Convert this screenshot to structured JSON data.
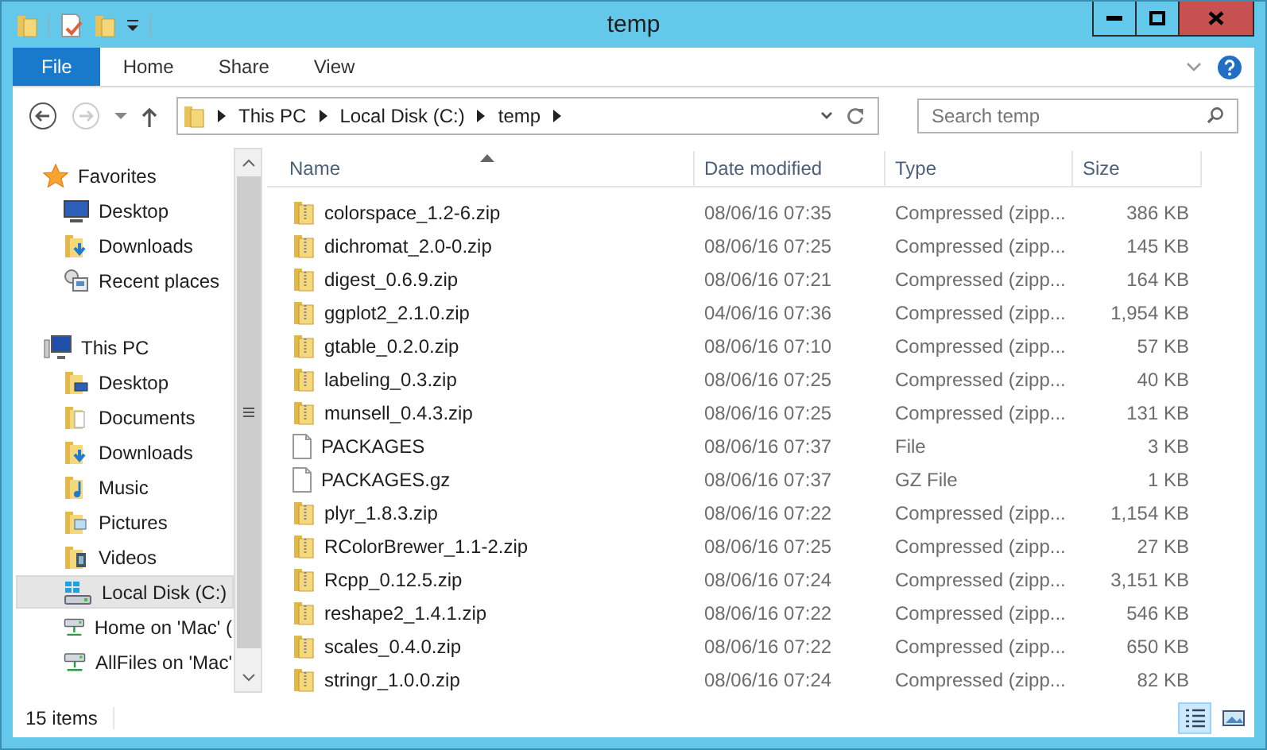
{
  "window": {
    "title": "temp"
  },
  "ribbon_tabs": [
    {
      "label": "File",
      "selected": true
    },
    {
      "label": "Home",
      "selected": false
    },
    {
      "label": "Share",
      "selected": false
    },
    {
      "label": "View",
      "selected": false
    }
  ],
  "address": {
    "segments": [
      "This PC",
      "Local Disk (C:)",
      "temp"
    ]
  },
  "search": {
    "placeholder": "Search temp"
  },
  "sidebar": {
    "groups": [
      {
        "label": "Favorites",
        "kind": "star",
        "children": [
          {
            "label": "Desktop",
            "kind": "monitor",
            "selected": false
          },
          {
            "label": "Downloads",
            "kind": "downloads",
            "selected": false
          },
          {
            "label": "Recent places",
            "kind": "recent",
            "selected": false
          }
        ]
      },
      {
        "label": "This PC",
        "kind": "pc",
        "children": [
          {
            "label": "Desktop",
            "kind": "folder-desktop",
            "selected": false
          },
          {
            "label": "Documents",
            "kind": "folder-docs",
            "selected": false
          },
          {
            "label": "Downloads",
            "kind": "downloads",
            "selected": false
          },
          {
            "label": "Music",
            "kind": "folder-music",
            "selected": false
          },
          {
            "label": "Pictures",
            "kind": "folder-pictures",
            "selected": false
          },
          {
            "label": "Videos",
            "kind": "folder-videos",
            "selected": false
          },
          {
            "label": "Local Disk (C:)",
            "kind": "drive",
            "selected": true
          },
          {
            "label": "Home on 'Mac' (",
            "kind": "network",
            "selected": false
          },
          {
            "label": "AllFiles on 'Mac'",
            "kind": "network",
            "selected": false
          }
        ]
      }
    ]
  },
  "table": {
    "columns": [
      "Name",
      "Date modified",
      "Type",
      "Size"
    ],
    "rows": [
      {
        "kind": "zip",
        "name": "colorspace_1.2-6.zip",
        "date": "08/06/16 07:35",
        "type": "Compressed (zipp...",
        "size": "386 KB"
      },
      {
        "kind": "zip",
        "name": "dichromat_2.0-0.zip",
        "date": "08/06/16 07:25",
        "type": "Compressed (zipp...",
        "size": "145 KB"
      },
      {
        "kind": "zip",
        "name": "digest_0.6.9.zip",
        "date": "08/06/16 07:21",
        "type": "Compressed (zipp...",
        "size": "164 KB"
      },
      {
        "kind": "zip",
        "name": "ggplot2_2.1.0.zip",
        "date": "04/06/16 07:36",
        "type": "Compressed (zipp...",
        "size": "1,954 KB"
      },
      {
        "kind": "zip",
        "name": "gtable_0.2.0.zip",
        "date": "08/06/16 07:10",
        "type": "Compressed (zipp...",
        "size": "57 KB"
      },
      {
        "kind": "zip",
        "name": "labeling_0.3.zip",
        "date": "08/06/16 07:25",
        "type": "Compressed (zipp...",
        "size": "40 KB"
      },
      {
        "kind": "zip",
        "name": "munsell_0.4.3.zip",
        "date": "08/06/16 07:25",
        "type": "Compressed (zipp...",
        "size": "131 KB"
      },
      {
        "kind": "file",
        "name": "PACKAGES",
        "date": "08/06/16 07:37",
        "type": "File",
        "size": "3 KB"
      },
      {
        "kind": "file",
        "name": "PACKAGES.gz",
        "date": "08/06/16 07:37",
        "type": "GZ File",
        "size": "1 KB"
      },
      {
        "kind": "zip",
        "name": "plyr_1.8.3.zip",
        "date": "08/06/16 07:22",
        "type": "Compressed (zipp...",
        "size": "1,154 KB"
      },
      {
        "kind": "zip",
        "name": "RColorBrewer_1.1-2.zip",
        "date": "08/06/16 07:25",
        "type": "Compressed (zipp...",
        "size": "27 KB"
      },
      {
        "kind": "zip",
        "name": "Rcpp_0.12.5.zip",
        "date": "08/06/16 07:24",
        "type": "Compressed (zipp...",
        "size": "3,151 KB"
      },
      {
        "kind": "zip",
        "name": "reshape2_1.4.1.zip",
        "date": "08/06/16 07:22",
        "type": "Compressed (zipp...",
        "size": "546 KB"
      },
      {
        "kind": "zip",
        "name": "scales_0.4.0.zip",
        "date": "08/06/16 07:22",
        "type": "Compressed (zipp...",
        "size": "650 KB"
      },
      {
        "kind": "zip",
        "name": "stringr_1.0.0.zip",
        "date": "08/06/16 07:24",
        "type": "Compressed (zipp...",
        "size": "82 KB"
      }
    ]
  },
  "status_bar": {
    "count": "15 items"
  }
}
